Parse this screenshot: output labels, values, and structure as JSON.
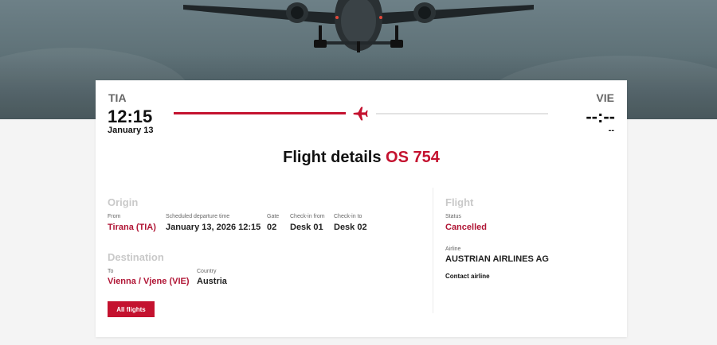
{
  "route": {
    "origin_code": "TIA",
    "origin_time": "12:15",
    "origin_date": "January 13",
    "dest_code": "VIE",
    "dest_time": "--:--",
    "dest_date": "--",
    "progress": 0.5
  },
  "title": {
    "prefix": "Flight details",
    "number": "OS 754"
  },
  "origin": {
    "heading": "Origin",
    "from_label": "From",
    "from_value": "Tirana (TIA)",
    "sched_label": "Scheduled departure time",
    "sched_value": "January 13, 2026 12:15",
    "gate_label": "Gate",
    "gate_value": "02",
    "checkin_from_label": "Check-in from",
    "checkin_from_value": "Desk 01",
    "checkin_to_label": "Check-in to",
    "checkin_to_value": "Desk 02"
  },
  "destination": {
    "heading": "Destination",
    "to_label": "To",
    "to_value": "Vienna / Vjene (VIE)",
    "country_label": "Country",
    "country_value": "Austria"
  },
  "flight": {
    "heading": "Flight",
    "status_label": "Status",
    "status_value": "Cancelled",
    "airline_label": "Airline",
    "airline_value": "AUSTRIAN AIRLINES AG",
    "contact_label": "Contact airline"
  },
  "actions": {
    "all_flights": "All flights"
  },
  "colors": {
    "accent": "#c4122f",
    "status": "#b01535"
  },
  "icons": [
    "airplane-icon",
    "airplane-photo"
  ]
}
